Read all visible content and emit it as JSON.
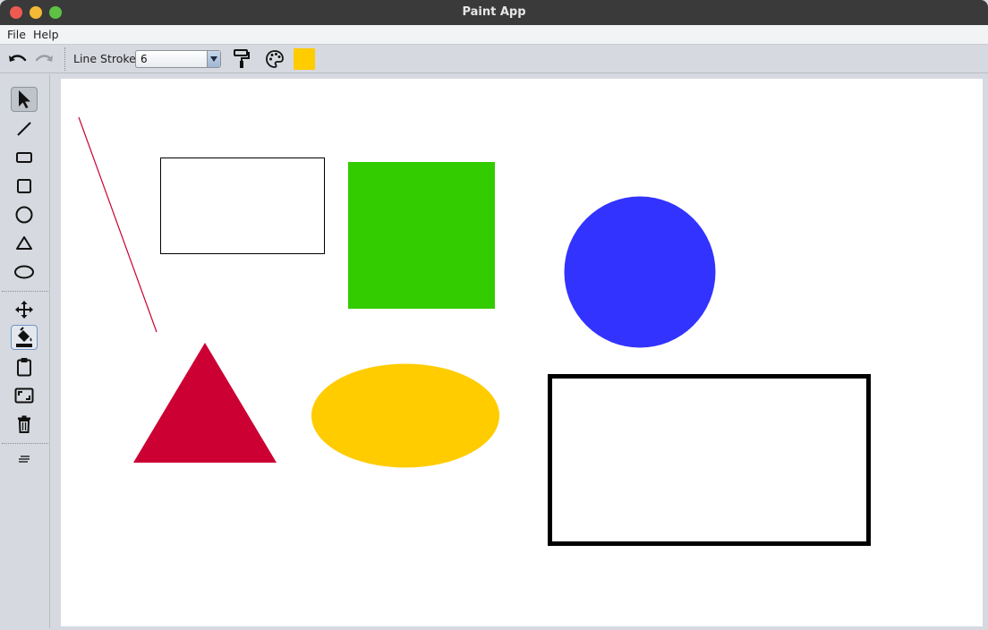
{
  "window": {
    "title": "Paint App"
  },
  "menu": {
    "file": "File",
    "help": "Help"
  },
  "toolbar": {
    "line_stroke_label": "Line Stroke",
    "line_stroke_value": "6",
    "current_color": "#ffcc00",
    "icons": [
      "undo-icon",
      "redo-icon",
      "paint-roller-icon",
      "palette-icon"
    ]
  },
  "tools": [
    {
      "name": "select",
      "icon": "cursor-icon",
      "selected": true
    },
    {
      "name": "line",
      "icon": "line-icon"
    },
    {
      "name": "rectangle",
      "icon": "rectangle-icon"
    },
    {
      "name": "square",
      "icon": "square-icon"
    },
    {
      "name": "circle",
      "icon": "circle-icon"
    },
    {
      "name": "triangle",
      "icon": "triangle-icon"
    },
    {
      "name": "ellipse",
      "icon": "ellipse-icon"
    },
    {
      "name": "move",
      "icon": "move-icon"
    },
    {
      "name": "fill",
      "icon": "paint-bucket-icon",
      "active": true
    },
    {
      "name": "paste",
      "icon": "clipboard-icon"
    },
    {
      "name": "resize",
      "icon": "resize-icon"
    },
    {
      "name": "delete",
      "icon": "trash-icon"
    },
    {
      "name": "more",
      "icon": "menu-lines-icon"
    }
  ],
  "canvas_shapes": [
    {
      "type": "line",
      "stroke": "#cc0033"
    },
    {
      "type": "rectangle",
      "stroke": "#000000",
      "fill": "none"
    },
    {
      "type": "square",
      "fill": "#33cc00"
    },
    {
      "type": "circle",
      "fill": "#3333ff"
    },
    {
      "type": "triangle",
      "fill": "#cc0033"
    },
    {
      "type": "ellipse",
      "fill": "#ffcc00"
    },
    {
      "type": "rectangle",
      "stroke": "#000000",
      "fill": "none",
      "stroke_width": 6
    }
  ]
}
